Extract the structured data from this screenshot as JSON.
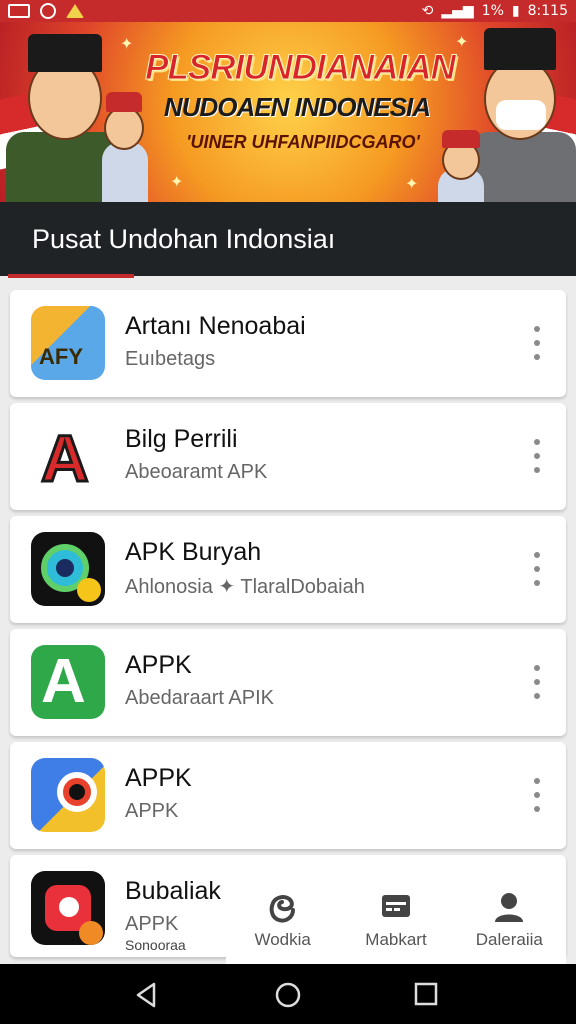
{
  "status_bar": {
    "time": "8:115",
    "battery": "1%"
  },
  "banner": {
    "title_line1": "PLSRIUNDIANAIAN",
    "title_line2": "NUDOAEN INDONESIA",
    "title_line3": "'UINER UHFANPIIDCGARO'"
  },
  "app_bar": {
    "title": "Pusat Undohan Indonsiaı"
  },
  "apps": [
    {
      "name": "Artanı Nenoabai",
      "subtitle": "Euıbetags",
      "icon": "artan-app-icon"
    },
    {
      "name": "Bilg Perrili",
      "subtitle": "Abeoaramt APK",
      "icon": "bilg-app-icon"
    },
    {
      "name": "APK Buryah",
      "subtitle": "Ahlonosia ✦ TlaralDobaiah",
      "icon": "apk-buryah-app-icon"
    },
    {
      "name": "APPK",
      "subtitle": "Abedaraart APIK",
      "icon": "appk-green-app-icon"
    },
    {
      "name": "APPK",
      "subtitle": "APPK",
      "icon": "appk-blue-app-icon"
    },
    {
      "name": "Bubaliak",
      "subtitle": "APPK",
      "subtitle2": "Sonooraa",
      "icon": "bubaliak-app-icon"
    }
  ],
  "bottom_nav": [
    {
      "label": "Wodkia",
      "icon": "e-icon"
    },
    {
      "label": "Mabkart",
      "icon": "cart-icon"
    },
    {
      "label": "Daleraiia",
      "icon": "profile-icon"
    }
  ],
  "colors": {
    "accent": "#c62b2b",
    "appbar": "#1f2326"
  }
}
